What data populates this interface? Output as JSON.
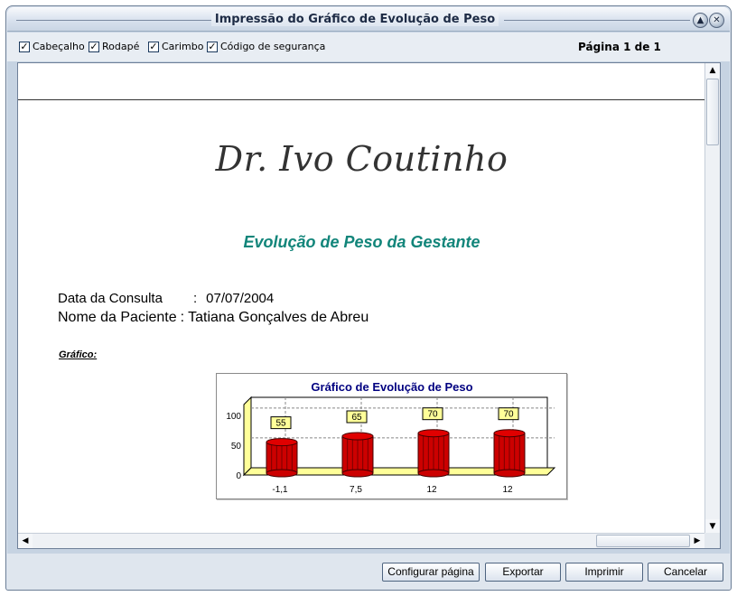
{
  "window": {
    "title": "Impressão do Gráfico de Evolução de Peso"
  },
  "options": {
    "items": [
      {
        "label": "Cabeçalho",
        "checked": true
      },
      {
        "label": "Rodapé",
        "checked": true
      },
      {
        "label": "Carimbo",
        "checked": true
      },
      {
        "label": "Código de segurança",
        "checked": true
      }
    ],
    "page_info": "Página 1 de 1"
  },
  "document": {
    "doctor_name": "Dr. Ivo Coutinho",
    "title": "Evolução de Peso da Gestante",
    "consult_label": "Data da Consulta",
    "consult_sep": ":",
    "consult_value": "07/07/2004",
    "patient_label": "Nome da Paciente",
    "patient_sep": ":",
    "patient_value": "Tatiana Gonçalves de Abreu",
    "chart_label": "Gráfico:"
  },
  "chart_data": {
    "type": "bar",
    "title": "Gráfico de Evolução de Peso",
    "categories": [
      "-1,1",
      "7,5",
      "12",
      "12"
    ],
    "values": [
      55,
      65,
      70,
      70
    ],
    "yticks": [
      0,
      50,
      100
    ],
    "ylim": [
      0,
      130
    ],
    "xlabel": "",
    "ylabel": "",
    "grid": true,
    "colors": {
      "bar": "#cc0000",
      "label_bg": "#ffff99",
      "floor": "#ffff99",
      "title": "#000080"
    }
  },
  "buttons": {
    "configure": "Configurar página",
    "export": "Exportar",
    "print": "Imprimir",
    "cancel": "Cancelar"
  },
  "icons": {
    "collapse": "eject-icon",
    "close": "close-icon"
  }
}
